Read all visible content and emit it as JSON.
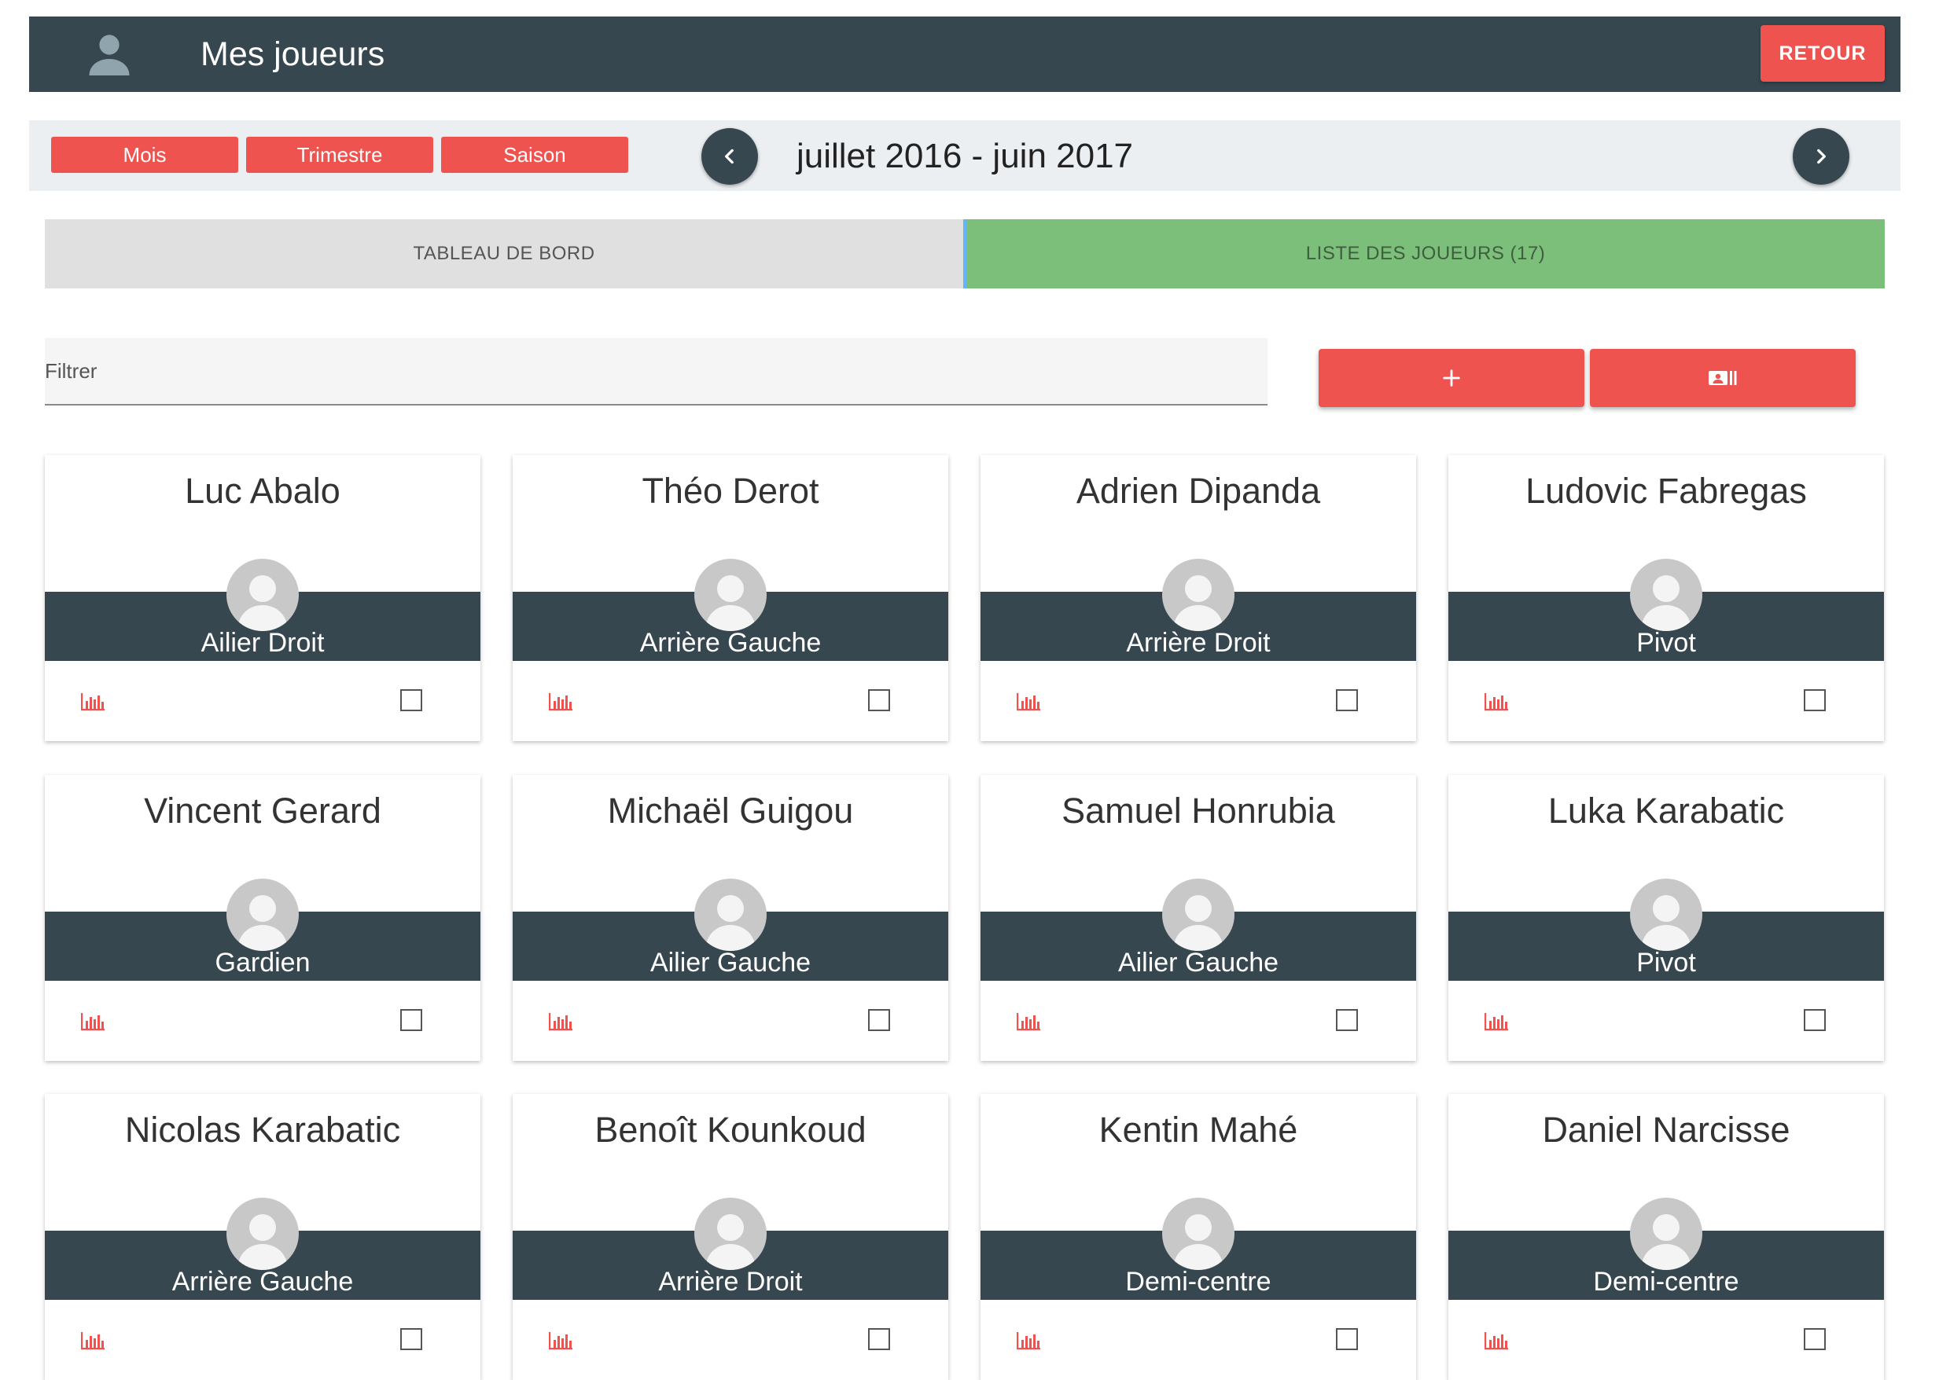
{
  "header": {
    "title": "Mes joueurs",
    "back_label": "RETOUR"
  },
  "period": {
    "buttons": [
      "Mois",
      "Trimestre",
      "Saison"
    ],
    "label": "juillet 2016 - juin 2017"
  },
  "tabs": [
    {
      "label": "TABLEAU DE BORD",
      "active": false
    },
    {
      "label": "LISTE DES JOUEURS (17)",
      "active": true
    }
  ],
  "filter": {
    "placeholder": "Filtrer",
    "value": ""
  },
  "actions": {
    "add_icon": "plus-icon",
    "list_icon": "contact-card-icon"
  },
  "players": [
    {
      "name": "Luc Abalo",
      "position": "Ailier Droit"
    },
    {
      "name": "Théo Derot",
      "position": "Arrière Gauche"
    },
    {
      "name": "Adrien Dipanda",
      "position": "Arrière Droit"
    },
    {
      "name": "Ludovic Fabregas",
      "position": "Pivot"
    },
    {
      "name": "Vincent Gerard",
      "position": "Gardien"
    },
    {
      "name": "Michaël Guigou",
      "position": "Ailier Gauche"
    },
    {
      "name": "Samuel Honrubia",
      "position": "Ailier Gauche"
    },
    {
      "name": "Luka Karabatic",
      "position": "Pivot"
    },
    {
      "name": "Nicolas Karabatic",
      "position": "Arrière Gauche"
    },
    {
      "name": "Benoît Kounkoud",
      "position": "Arrière Droit"
    },
    {
      "name": "Kentin Mahé",
      "position": "Demi-centre"
    },
    {
      "name": "Daniel Narcisse",
      "position": "Demi-centre"
    }
  ],
  "colors": {
    "accent": "#ef5350",
    "dark": "#37474f",
    "active_tab": "#7bbf7b"
  }
}
